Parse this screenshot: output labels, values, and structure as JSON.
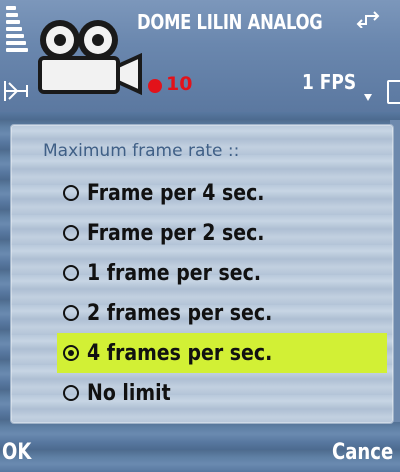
{
  "header": {
    "camera_name": "DOME LILIN ANALOG",
    "record_count": "10",
    "fps": "1 FPS",
    "icons": [
      "signal-strength-icon",
      "antenna-icon",
      "video-camera-icon",
      "network-icon",
      "battery-icon"
    ],
    "colors": {
      "record": "#e3121a",
      "text": "#ffffff"
    }
  },
  "dialog": {
    "title": "Maximum frame rate ::",
    "options": [
      {
        "label": "Frame per 4 sec.",
        "selected": false
      },
      {
        "label": "Frame per 2 sec.",
        "selected": false
      },
      {
        "label": "1 frame per sec.",
        "selected": false
      },
      {
        "label": "2 frames per sec.",
        "selected": false
      },
      {
        "label": "4 frames per sec.",
        "selected": true
      },
      {
        "label": "No limit",
        "selected": false
      }
    ],
    "highlight_color": "#d2f035"
  },
  "softkeys": {
    "left": "OK",
    "right": "Cance"
  }
}
